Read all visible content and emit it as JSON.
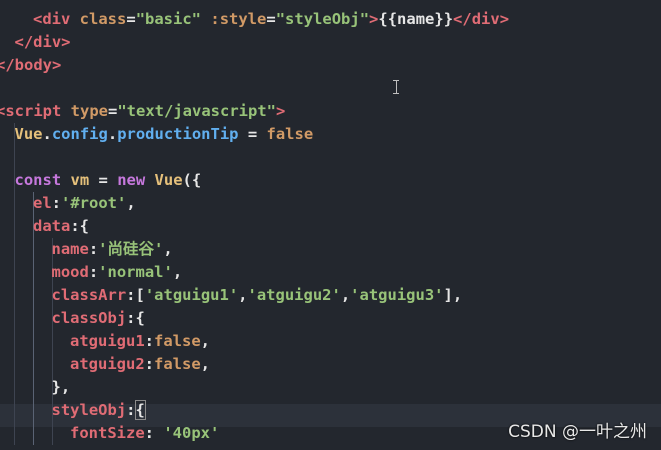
{
  "editor": {
    "watermark": "CSDN @一叶之州",
    "lines": [
      {
        "indent": 2,
        "tokens": [
          [
            "tag",
            "<div"
          ],
          [
            "plain",
            " "
          ],
          [
            "attr",
            "class"
          ],
          [
            "plain",
            "="
          ],
          [
            "str",
            "\"basic\""
          ],
          [
            "plain",
            " "
          ],
          [
            "attr",
            ":style"
          ],
          [
            "plain",
            "="
          ],
          [
            "str",
            "\"styleObj\""
          ],
          [
            "tag",
            ">"
          ],
          [
            "plain",
            "{{name}}"
          ],
          [
            "tag",
            "</div>"
          ]
        ]
      },
      {
        "indent": 1,
        "tokens": [
          [
            "tag",
            "</div>"
          ]
        ]
      },
      {
        "indent": 0,
        "tokens": [
          [
            "tag",
            "</body>"
          ]
        ]
      },
      {
        "indent": 0,
        "tokens": []
      },
      {
        "indent": 0,
        "tokens": [
          [
            "tag",
            "<script"
          ],
          [
            "plain",
            " "
          ],
          [
            "attr",
            "type"
          ],
          [
            "plain",
            "="
          ],
          [
            "str",
            "\"text/javascript\""
          ],
          [
            "tag",
            ">"
          ]
        ]
      },
      {
        "indent": 1,
        "tokens": [
          [
            "var",
            "Vue"
          ],
          [
            "plain",
            "."
          ],
          [
            "prop",
            "config"
          ],
          [
            "plain",
            "."
          ],
          [
            "prop",
            "productionTip"
          ],
          [
            "plain",
            " = "
          ],
          [
            "bool",
            "false"
          ]
        ]
      },
      {
        "indent": 0,
        "tokens": []
      },
      {
        "indent": 1,
        "tokens": [
          [
            "kw",
            "const"
          ],
          [
            "plain",
            " "
          ],
          [
            "var",
            "vm"
          ],
          [
            "plain",
            " = "
          ],
          [
            "kw",
            "new"
          ],
          [
            "plain",
            " "
          ],
          [
            "fn",
            "Vue"
          ],
          [
            "plain",
            "({"
          ]
        ]
      },
      {
        "indent": 2,
        "tokens": [
          [
            "key",
            "el"
          ],
          [
            "plain",
            ":"
          ],
          [
            "str",
            "'#root'"
          ],
          [
            "plain",
            ","
          ]
        ]
      },
      {
        "indent": 2,
        "tokens": [
          [
            "key",
            "data"
          ],
          [
            "plain",
            ":{"
          ]
        ]
      },
      {
        "indent": 3,
        "tokens": [
          [
            "key",
            "name"
          ],
          [
            "plain",
            ":"
          ],
          [
            "str",
            "'尚硅谷'"
          ],
          [
            "plain",
            ","
          ]
        ]
      },
      {
        "indent": 3,
        "tokens": [
          [
            "key",
            "mood"
          ],
          [
            "plain",
            ":"
          ],
          [
            "str",
            "'normal'"
          ],
          [
            "plain",
            ","
          ]
        ]
      },
      {
        "indent": 3,
        "tokens": [
          [
            "key",
            "classArr"
          ],
          [
            "plain",
            ":["
          ],
          [
            "str",
            "'atguigu1'"
          ],
          [
            "plain",
            ","
          ],
          [
            "str",
            "'atguigu2'"
          ],
          [
            "plain",
            ","
          ],
          [
            "str",
            "'atguigu3'"
          ],
          [
            "plain",
            "],"
          ]
        ]
      },
      {
        "indent": 3,
        "tokens": [
          [
            "key",
            "classObj"
          ],
          [
            "plain",
            ":{"
          ]
        ]
      },
      {
        "indent": 4,
        "tokens": [
          [
            "key",
            "atguigu1"
          ],
          [
            "plain",
            ":"
          ],
          [
            "bool",
            "false"
          ],
          [
            "plain",
            ","
          ]
        ]
      },
      {
        "indent": 4,
        "tokens": [
          [
            "key",
            "atguigu2"
          ],
          [
            "plain",
            ":"
          ],
          [
            "bool",
            "false"
          ],
          [
            "plain",
            ","
          ]
        ]
      },
      {
        "indent": 3,
        "tokens": [
          [
            "plain",
            "},"
          ]
        ]
      },
      {
        "indent": 3,
        "tokens": [
          [
            "key",
            "styleObj"
          ],
          [
            "plain",
            ":"
          ],
          [
            "match",
            "{"
          ]
        ]
      },
      {
        "indent": 4,
        "tokens": [
          [
            "key",
            "fontSize"
          ],
          [
            "plain",
            ": "
          ],
          [
            "str",
            "'40px'"
          ]
        ]
      }
    ]
  }
}
